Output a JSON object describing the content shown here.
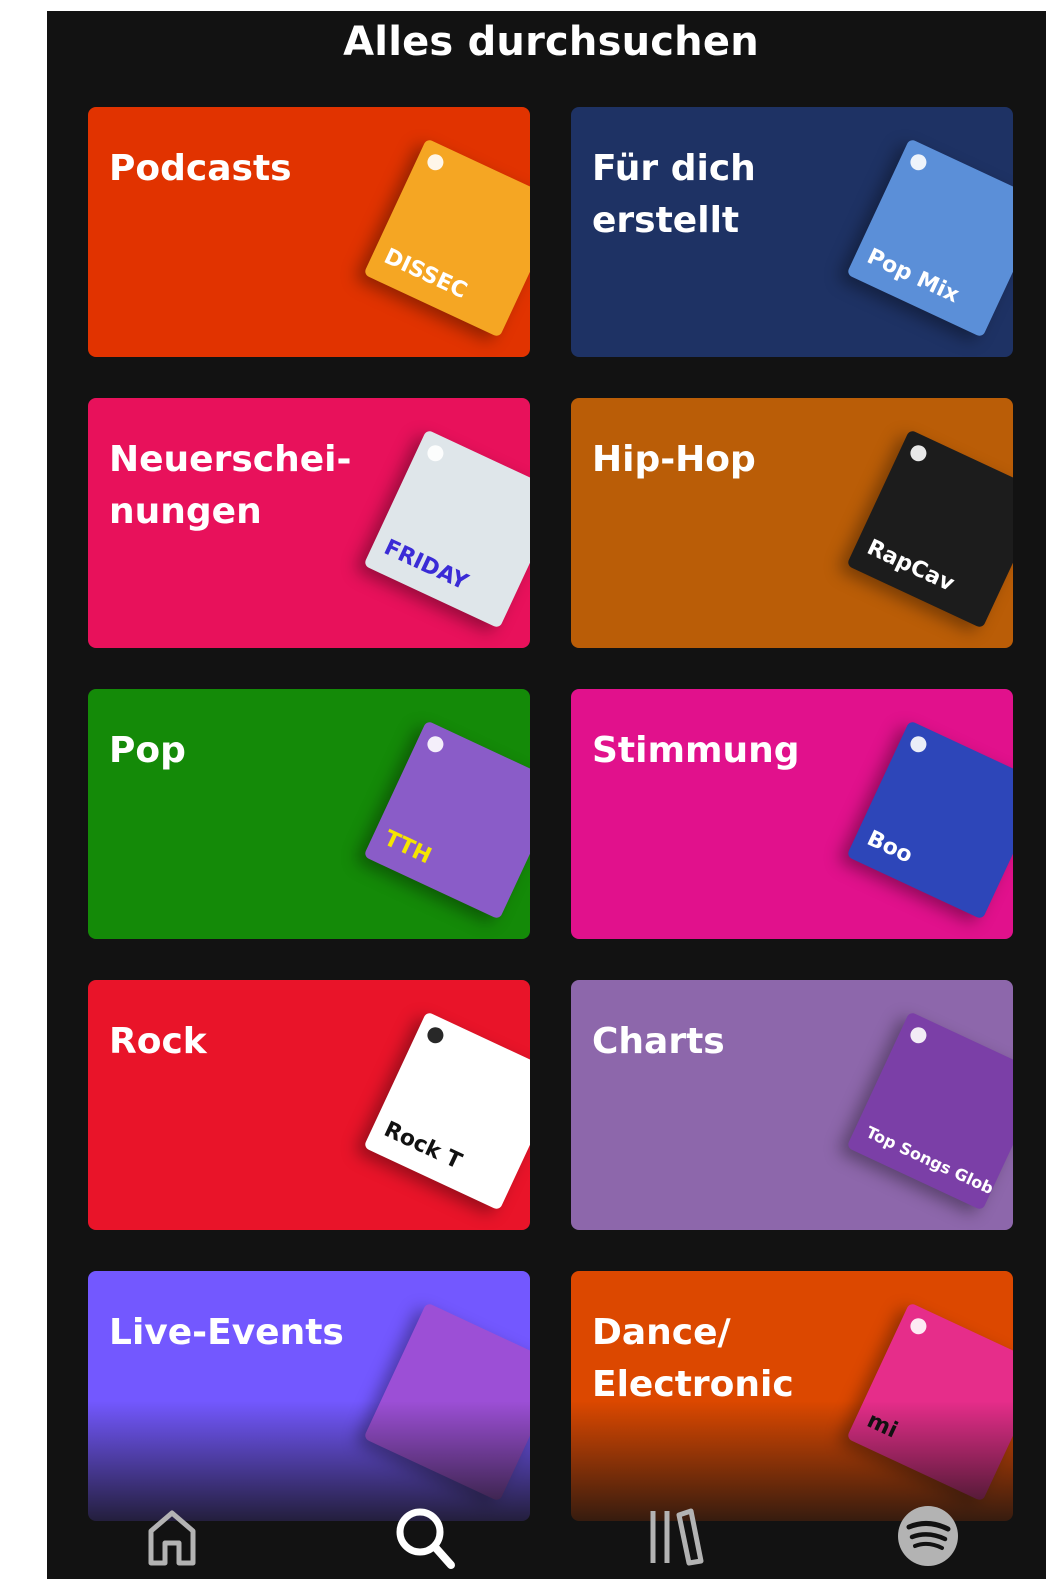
{
  "header": {
    "title": "Alles durchsuchen"
  },
  "categories": [
    {
      "label": "Podcasts",
      "color": "#e13300",
      "art_color": "#f5a623",
      "art_text": "DISSEC",
      "art_icon": "podcast-cover-icon"
    },
    {
      "label": "Für dich\nerstellt",
      "color": "#1e3264",
      "art_color": "#5b8fd8",
      "art_text": "Pop Mix",
      "art_icon": "pop-mix-cover-icon"
    },
    {
      "label": "Neuerschei-\nnungen",
      "color": "#e8115b",
      "art_color": "#dfe6ea",
      "art_text": "FRIDAY",
      "art_icon": "new-music-friday-cover-icon"
    },
    {
      "label": "Hip-Hop",
      "color": "#ba5d07",
      "art_color": "#1c1c1c",
      "art_text": "RapCav",
      "art_icon": "rapcaviar-cover-icon"
    },
    {
      "label": "Pop",
      "color": "#148a08",
      "art_color": "#8a5cc8",
      "art_text": "TTH",
      "art_icon": "today-top-hits-cover-icon"
    },
    {
      "label": "Stimmung",
      "color": "#e1118c",
      "art_color": "#2d46b9",
      "art_text": "Boo",
      "art_icon": "mood-booster-cover-icon"
    },
    {
      "label": "Rock",
      "color": "#e91429",
      "art_color": "#ffffff",
      "art_text": "Rock T",
      "art_icon": "rock-this-cover-icon"
    },
    {
      "label": "Charts",
      "color": "#8d67ab",
      "art_color": "#7b3fa7",
      "art_text": "Top Songs Global",
      "art_icon": "top-songs-global-cover-icon"
    },
    {
      "label": "Live-Events",
      "color": "#7358ff",
      "art_color": "#9c4fd6",
      "art_text": "",
      "art_icon": "live-events-cover-icon"
    },
    {
      "label": "Dance/\nElectronic",
      "color": "#dc4800",
      "art_color": "#e62d8a",
      "art_text": "mi",
      "art_icon": "mint-cover-icon"
    }
  ],
  "nav": {
    "items": [
      {
        "name": "home",
        "icon": "home-icon",
        "active": false
      },
      {
        "name": "search",
        "icon": "search-icon",
        "active": true
      },
      {
        "name": "library",
        "icon": "library-icon",
        "active": false
      },
      {
        "name": "premium",
        "icon": "spotify-logo-icon",
        "active": false
      }
    ]
  }
}
